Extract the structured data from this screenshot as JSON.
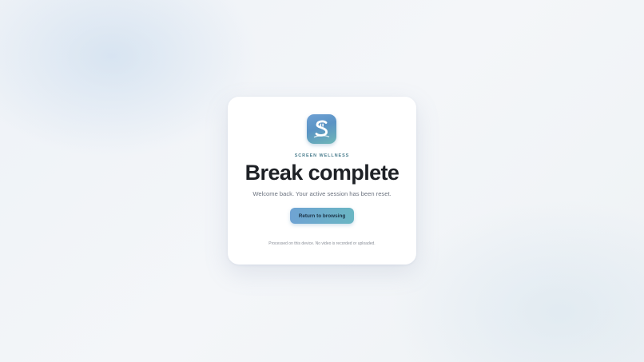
{
  "app": {
    "icon": "app-logo-icon",
    "brand_label": "SCREEN WELLNESS"
  },
  "dialog": {
    "title": "Break complete",
    "subtitle": "Welcome back. Your active session has been reset.",
    "primary_button_label": "Return to browsing",
    "footnote": "Processed on this device. No video is recorded or uploaded."
  },
  "colors": {
    "accent_start": "#6fa3d3",
    "accent_end": "#6ab6c3",
    "brand_text": "#4d7f8f",
    "title_text": "#1e2126"
  }
}
